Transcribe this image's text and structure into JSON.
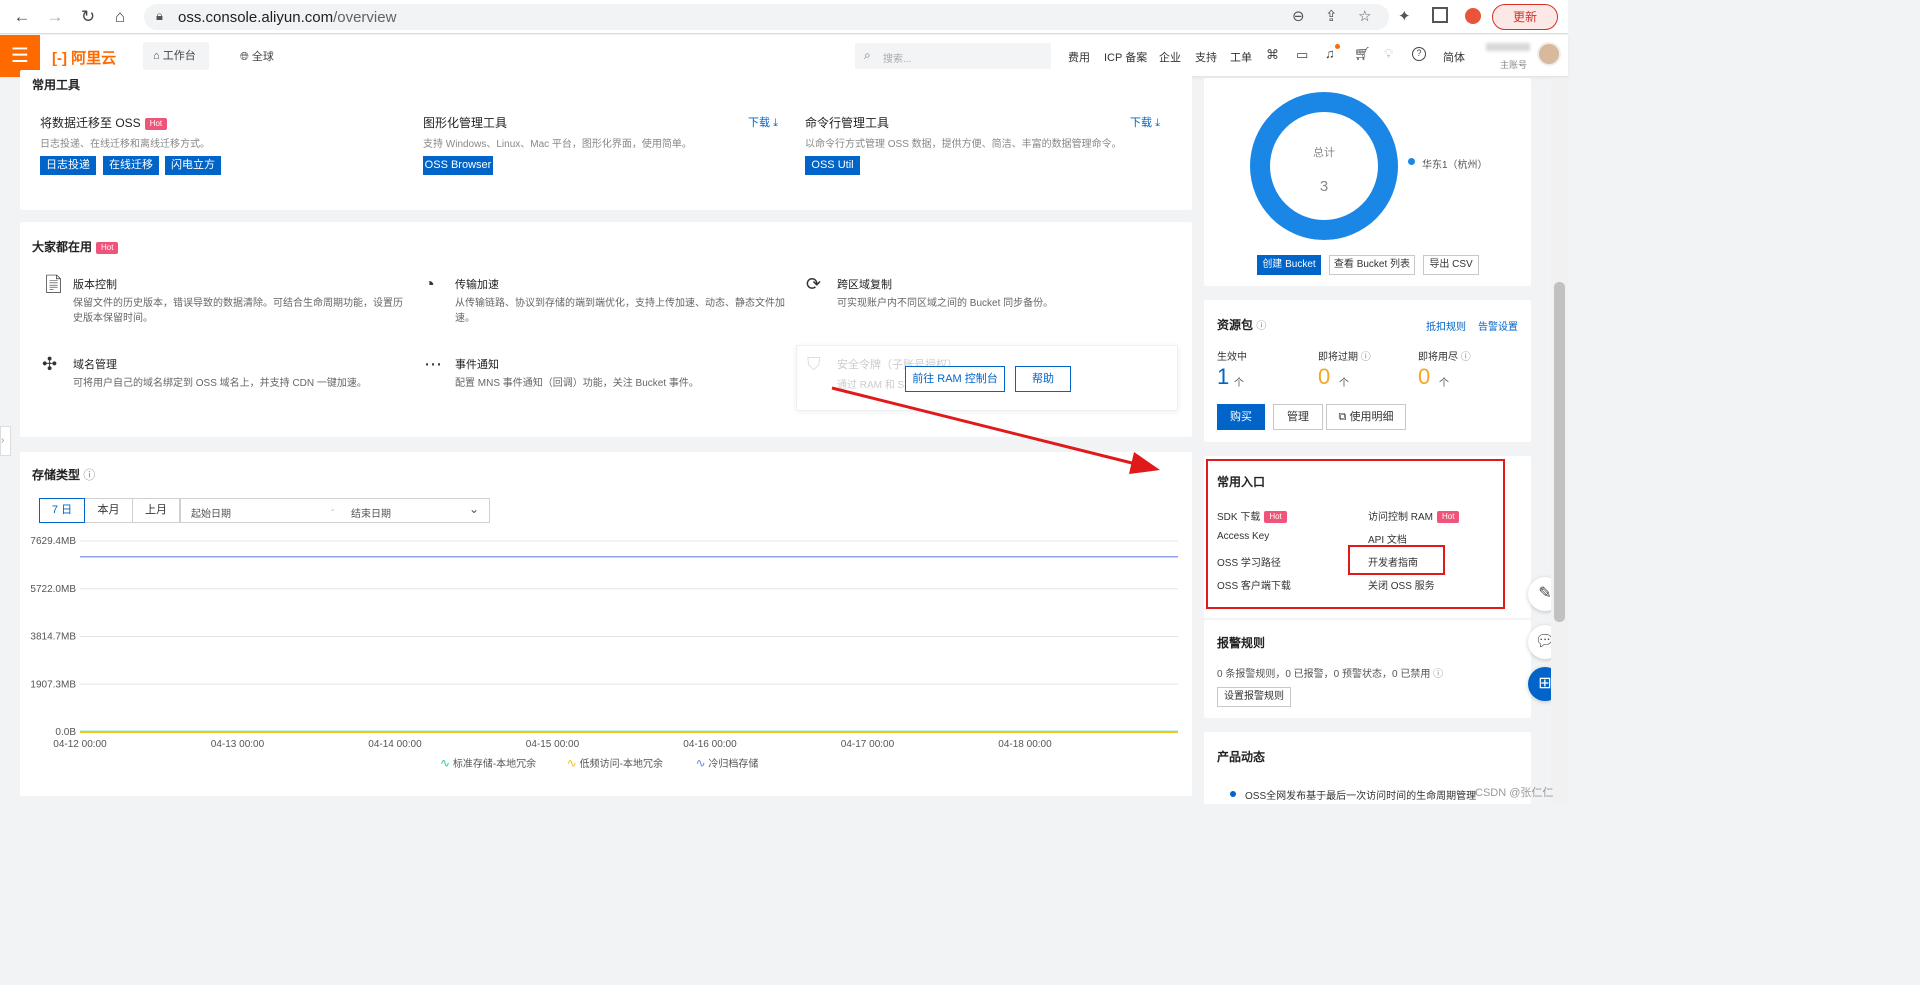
{
  "browser": {
    "url_host": "oss.console.aliyun.com",
    "url_path": "/overview",
    "update_label": "更新"
  },
  "topnav": {
    "logo_text": "阿里云",
    "workbench": "工作台",
    "region": "全球",
    "search_placeholder": "搜索...",
    "links": [
      "费用",
      "ICP 备案",
      "企业",
      "支持",
      "工单"
    ],
    "lang": "简体",
    "account_sub": "主账号"
  },
  "tools": {
    "title": "常用工具",
    "download_label": "下载",
    "items": [
      {
        "title": "将数据迁移至 OSS",
        "hot": "Hot",
        "desc": "日志投递、在线迁移和离线迁移方式。",
        "buttons": [
          "日志投递",
          "在线迁移",
          "闪电立方"
        ]
      },
      {
        "title": "图形化管理工具",
        "desc": "支持 Windows、Linux、Mac 平台，图形化界面，使用简单。",
        "buttons": [
          "OSS Browser"
        ]
      },
      {
        "title": "命令行管理工具",
        "desc": "以命令行方式管理 OSS 数据，提供方便、简洁、丰富的数据管理命令。",
        "buttons": [
          "OSS Util"
        ]
      }
    ]
  },
  "popular": {
    "title": "大家都在用",
    "hot": "Hot",
    "items": [
      {
        "title": "版本控制",
        "desc": "保留文件的历史版本，错误导致的数据清除。可结合生命周期功能，设置历史版本保留时间。",
        "icon": "document-icon"
      },
      {
        "title": "传输加速",
        "desc": "从传输链路、协议到存储的端到端优化，支持上传加速、动态、静态文件加速。",
        "icon": "speed-icon"
      },
      {
        "title": "跨区域复制",
        "desc": "可实现账户内不同区域之间的 Bucket 同步备份。",
        "icon": "replicate-icon"
      },
      {
        "title": "域名管理",
        "desc": "可将用户自己的域名绑定到 OSS 域名上，并支持 CDN 一键加速。",
        "icon": "network-icon"
      },
      {
        "title": "事件通知",
        "desc": "配置 MNS 事件通知（回调）功能，关注 Bucket 事件。",
        "icon": "message-icon"
      },
      {
        "title": "安全令牌（子账号授权）",
        "desc": "通过 RAM 和 STS",
        "icon": "shield-icon"
      }
    ],
    "ram_button": "前往 RAM 控制台",
    "help_button": "帮助"
  },
  "storage": {
    "title": "存储类型",
    "tabs": [
      "7 日",
      "本月",
      "上月"
    ],
    "start_placeholder": "起始日期",
    "date_separator": "-",
    "end_placeholder": "结束日期"
  },
  "chart_data": {
    "type": "line",
    "x": [
      "04-12 00:00",
      "04-13 00:00",
      "04-14 00:00",
      "04-15 00:00",
      "04-16 00:00",
      "04-17 00:00",
      "04-18 00:00"
    ],
    "ytick_labels": [
      "7629.4MB",
      "5722.0MB",
      "3814.7MB",
      "1907.3MB",
      "0.0B"
    ],
    "ylim": [
      0,
      7629.4
    ],
    "yunit": "MB",
    "series": [
      {
        "name": "标准存储-本地冗余",
        "color": "#2ec7a9",
        "values": [
          10,
          10,
          10,
          10,
          10,
          10,
          10
        ]
      },
      {
        "name": "低频访问-本地冗余",
        "color": "#f5c21b",
        "values": [
          0,
          0,
          0,
          0,
          0,
          0,
          0
        ]
      },
      {
        "name": "冷归档存储",
        "color": "#6b83e6",
        "values": [
          7000,
          7000,
          7000,
          7000,
          7000,
          7000,
          7000
        ]
      }
    ],
    "grid": true,
    "legend": "bottom"
  },
  "bucket": {
    "total_label": "总计",
    "total_value": "3",
    "region_legend": "华东1（杭州）",
    "buttons": [
      "创建 Bucket",
      "查看 Bucket 列表",
      "导出 CSV"
    ]
  },
  "resource": {
    "title": "资源包",
    "links": [
      "抵扣规则",
      "告警设置"
    ],
    "stats": [
      {
        "label": "生效中",
        "value": "1",
        "unit": "个",
        "color": "#0064c8"
      },
      {
        "label": "即将过期",
        "value": "0",
        "unit": "个",
        "color": "#f5a623"
      },
      {
        "label": "即将用尽",
        "value": "0",
        "unit": "个",
        "color": "#f5a623"
      }
    ],
    "buttons": [
      "购买",
      "管理",
      "使用明细"
    ]
  },
  "entries": {
    "title": "常用入口",
    "left": [
      "SDK 下载",
      "Access Key",
      "OSS 学习路径",
      "OSS 客户端下载"
    ],
    "right": [
      "访问控制 RAM",
      "API 文档",
      "开发者指南",
      "关闭 OSS 服务"
    ],
    "hot": "Hot"
  },
  "alarm": {
    "title": "报警规则",
    "summary": "0 条报警规则，0 已报警，0 预警状态，0 已禁用",
    "button": "设置报警规则"
  },
  "news": {
    "title": "产品动态",
    "items": [
      "OSS全网发布基于最后一次访问时间的生命周期管理"
    ]
  },
  "watermark": "CSDN @张仁仁"
}
